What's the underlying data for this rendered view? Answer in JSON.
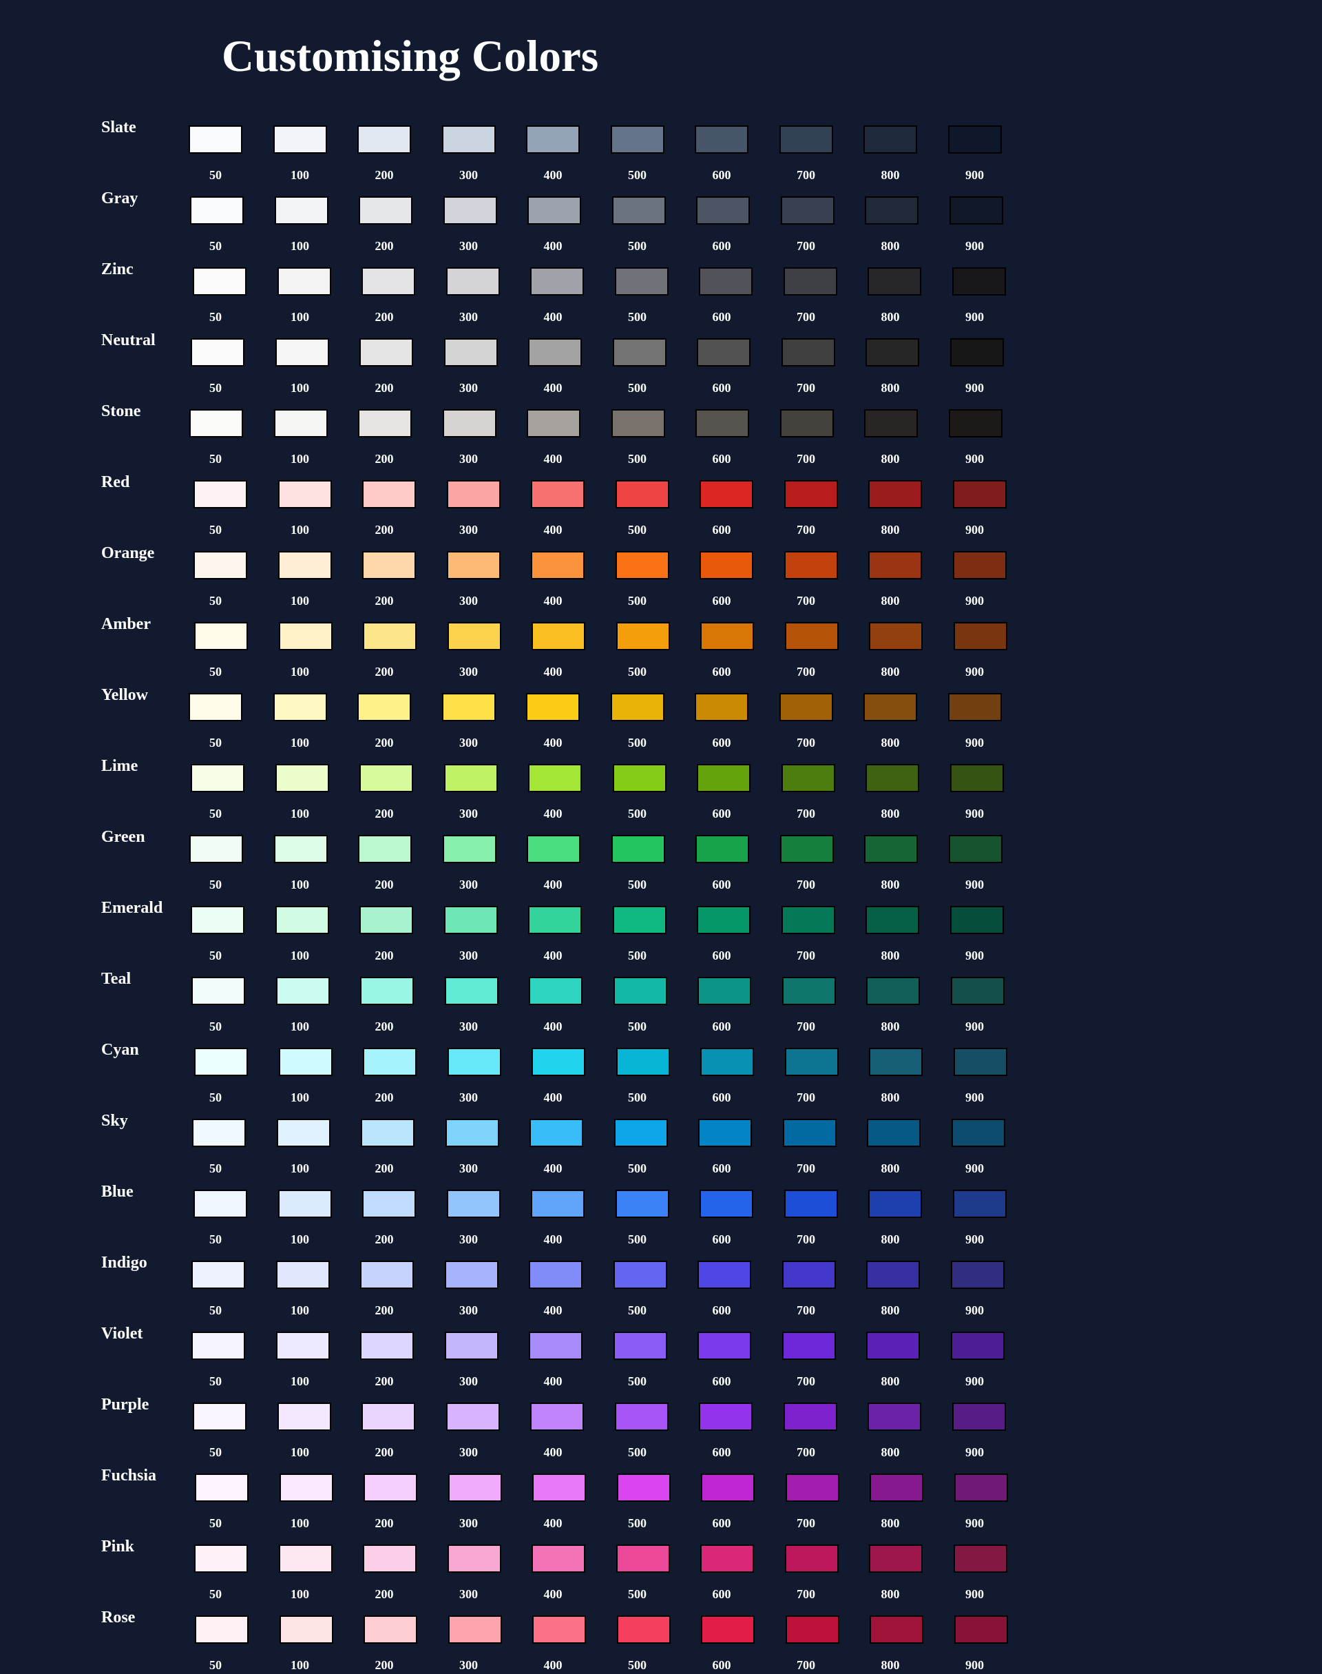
{
  "title": "Customising Colors",
  "shade_labels": [
    "50",
    "100",
    "200",
    "300",
    "400",
    "500",
    "600",
    "700",
    "800",
    "900"
  ],
  "palettes": [
    {
      "name": "Slate",
      "colors": [
        "#f8fafc",
        "#f1f5f9",
        "#e2e8f0",
        "#cbd5e1",
        "#94a3b8",
        "#64748b",
        "#475569",
        "#334155",
        "#1e293b",
        "#0f172a"
      ]
    },
    {
      "name": "Gray",
      "colors": [
        "#f9fafb",
        "#f3f4f6",
        "#e5e7eb",
        "#d1d5db",
        "#9ca3af",
        "#6b7280",
        "#4b5563",
        "#374151",
        "#1f2937",
        "#111827"
      ]
    },
    {
      "name": "Zinc",
      "colors": [
        "#fafafa",
        "#f4f4f5",
        "#e4e4e7",
        "#d4d4d8",
        "#a1a1aa",
        "#71717a",
        "#52525b",
        "#3f3f46",
        "#27272a",
        "#18181b"
      ]
    },
    {
      "name": "Neutral",
      "colors": [
        "#fafafa",
        "#f5f5f5",
        "#e5e5e5",
        "#d4d4d4",
        "#a3a3a3",
        "#737373",
        "#525252",
        "#404040",
        "#262626",
        "#171717"
      ]
    },
    {
      "name": "Stone",
      "colors": [
        "#fafaf9",
        "#f5f5f4",
        "#e7e5e4",
        "#d6d3d1",
        "#a8a29e",
        "#78716c",
        "#57534e",
        "#44403c",
        "#292524",
        "#1c1917"
      ]
    },
    {
      "name": "Red",
      "colors": [
        "#fef2f2",
        "#fee2e2",
        "#fecaca",
        "#fca5a5",
        "#f87171",
        "#ef4444",
        "#dc2626",
        "#b91c1c",
        "#991b1b",
        "#7f1d1d"
      ]
    },
    {
      "name": "Orange",
      "colors": [
        "#fff7ed",
        "#ffedd5",
        "#fed7aa",
        "#fdba74",
        "#fb923c",
        "#f97316",
        "#ea580c",
        "#c2410c",
        "#9a3412",
        "#7c2d12"
      ]
    },
    {
      "name": "Amber",
      "colors": [
        "#fffbeb",
        "#fef3c7",
        "#fde68a",
        "#fcd34d",
        "#fbbf24",
        "#f59e0b",
        "#d97706",
        "#b45309",
        "#92400e",
        "#78350f"
      ]
    },
    {
      "name": "Yellow",
      "colors": [
        "#fefce8",
        "#fef9c3",
        "#fef08a",
        "#fde047",
        "#facc15",
        "#eab308",
        "#ca8a04",
        "#a16207",
        "#854d0e",
        "#713f12"
      ]
    },
    {
      "name": "Lime",
      "colors": [
        "#f7fee7",
        "#ecfccb",
        "#d9f99d",
        "#bef264",
        "#a3e635",
        "#84cc16",
        "#65a30d",
        "#4d7c0f",
        "#3f6212",
        "#365314"
      ]
    },
    {
      "name": "Green",
      "colors": [
        "#f0fdf4",
        "#dcfce7",
        "#bbf7d0",
        "#86efac",
        "#4ade80",
        "#22c55e",
        "#16a34a",
        "#15803d",
        "#166534",
        "#14532d"
      ]
    },
    {
      "name": "Emerald",
      "colors": [
        "#ecfdf5",
        "#d1fae5",
        "#a7f3d0",
        "#6ee7b7",
        "#34d399",
        "#10b981",
        "#059669",
        "#047857",
        "#065f46",
        "#064e3b"
      ]
    },
    {
      "name": "Teal",
      "colors": [
        "#f0fdfa",
        "#ccfbf1",
        "#99f6e4",
        "#5eead4",
        "#2dd4bf",
        "#14b8a6",
        "#0d9488",
        "#0f766e",
        "#115e59",
        "#134e4a"
      ]
    },
    {
      "name": "Cyan",
      "colors": [
        "#ecfeff",
        "#cffafe",
        "#a5f3fc",
        "#67e8f9",
        "#22d3ee",
        "#06b6d4",
        "#0891b2",
        "#0e7490",
        "#155e75",
        "#164e63"
      ]
    },
    {
      "name": "Sky",
      "colors": [
        "#f0f9ff",
        "#e0f2fe",
        "#bae6fd",
        "#7dd3fc",
        "#38bdf8",
        "#0ea5e9",
        "#0284c7",
        "#0369a1",
        "#075985",
        "#0c4a6e"
      ]
    },
    {
      "name": "Blue",
      "colors": [
        "#eff6ff",
        "#dbeafe",
        "#bfdbfe",
        "#93c5fd",
        "#60a5fa",
        "#3b82f6",
        "#2563eb",
        "#1d4ed8",
        "#1e40af",
        "#1e3a8a"
      ]
    },
    {
      "name": "Indigo",
      "colors": [
        "#eef2ff",
        "#e0e7ff",
        "#c7d2fe",
        "#a5b4fc",
        "#818cf8",
        "#6366f1",
        "#4f46e5",
        "#4338ca",
        "#3730a3",
        "#312e81"
      ]
    },
    {
      "name": "Violet",
      "colors": [
        "#f5f3ff",
        "#ede9fe",
        "#ddd6fe",
        "#c4b5fd",
        "#a78bfa",
        "#8b5cf6",
        "#7c3aed",
        "#6d28d9",
        "#5b21b6",
        "#4c1d95"
      ]
    },
    {
      "name": "Purple",
      "colors": [
        "#faf5ff",
        "#f3e8ff",
        "#e9d5ff",
        "#d8b4fe",
        "#c084fc",
        "#a855f7",
        "#9333ea",
        "#7e22ce",
        "#6b21a8",
        "#581c87"
      ]
    },
    {
      "name": "Fuchsia",
      "colors": [
        "#fdf4ff",
        "#fae8ff",
        "#f5d0fe",
        "#f0abfc",
        "#e879f9",
        "#d946ef",
        "#c026d3",
        "#a21caf",
        "#86198f",
        "#701a75"
      ]
    },
    {
      "name": "Pink",
      "colors": [
        "#fdf2f8",
        "#fce7f3",
        "#fbcfe8",
        "#f9a8d4",
        "#f472b6",
        "#ec4899",
        "#db2777",
        "#be185d",
        "#9d174d",
        "#831843"
      ]
    },
    {
      "name": "Rose",
      "colors": [
        "#fff1f2",
        "#ffe4e6",
        "#fecdd3",
        "#fda4af",
        "#fb7185",
        "#f43f5e",
        "#e11d48",
        "#be123c",
        "#9f1239",
        "#881337"
      ]
    }
  ]
}
